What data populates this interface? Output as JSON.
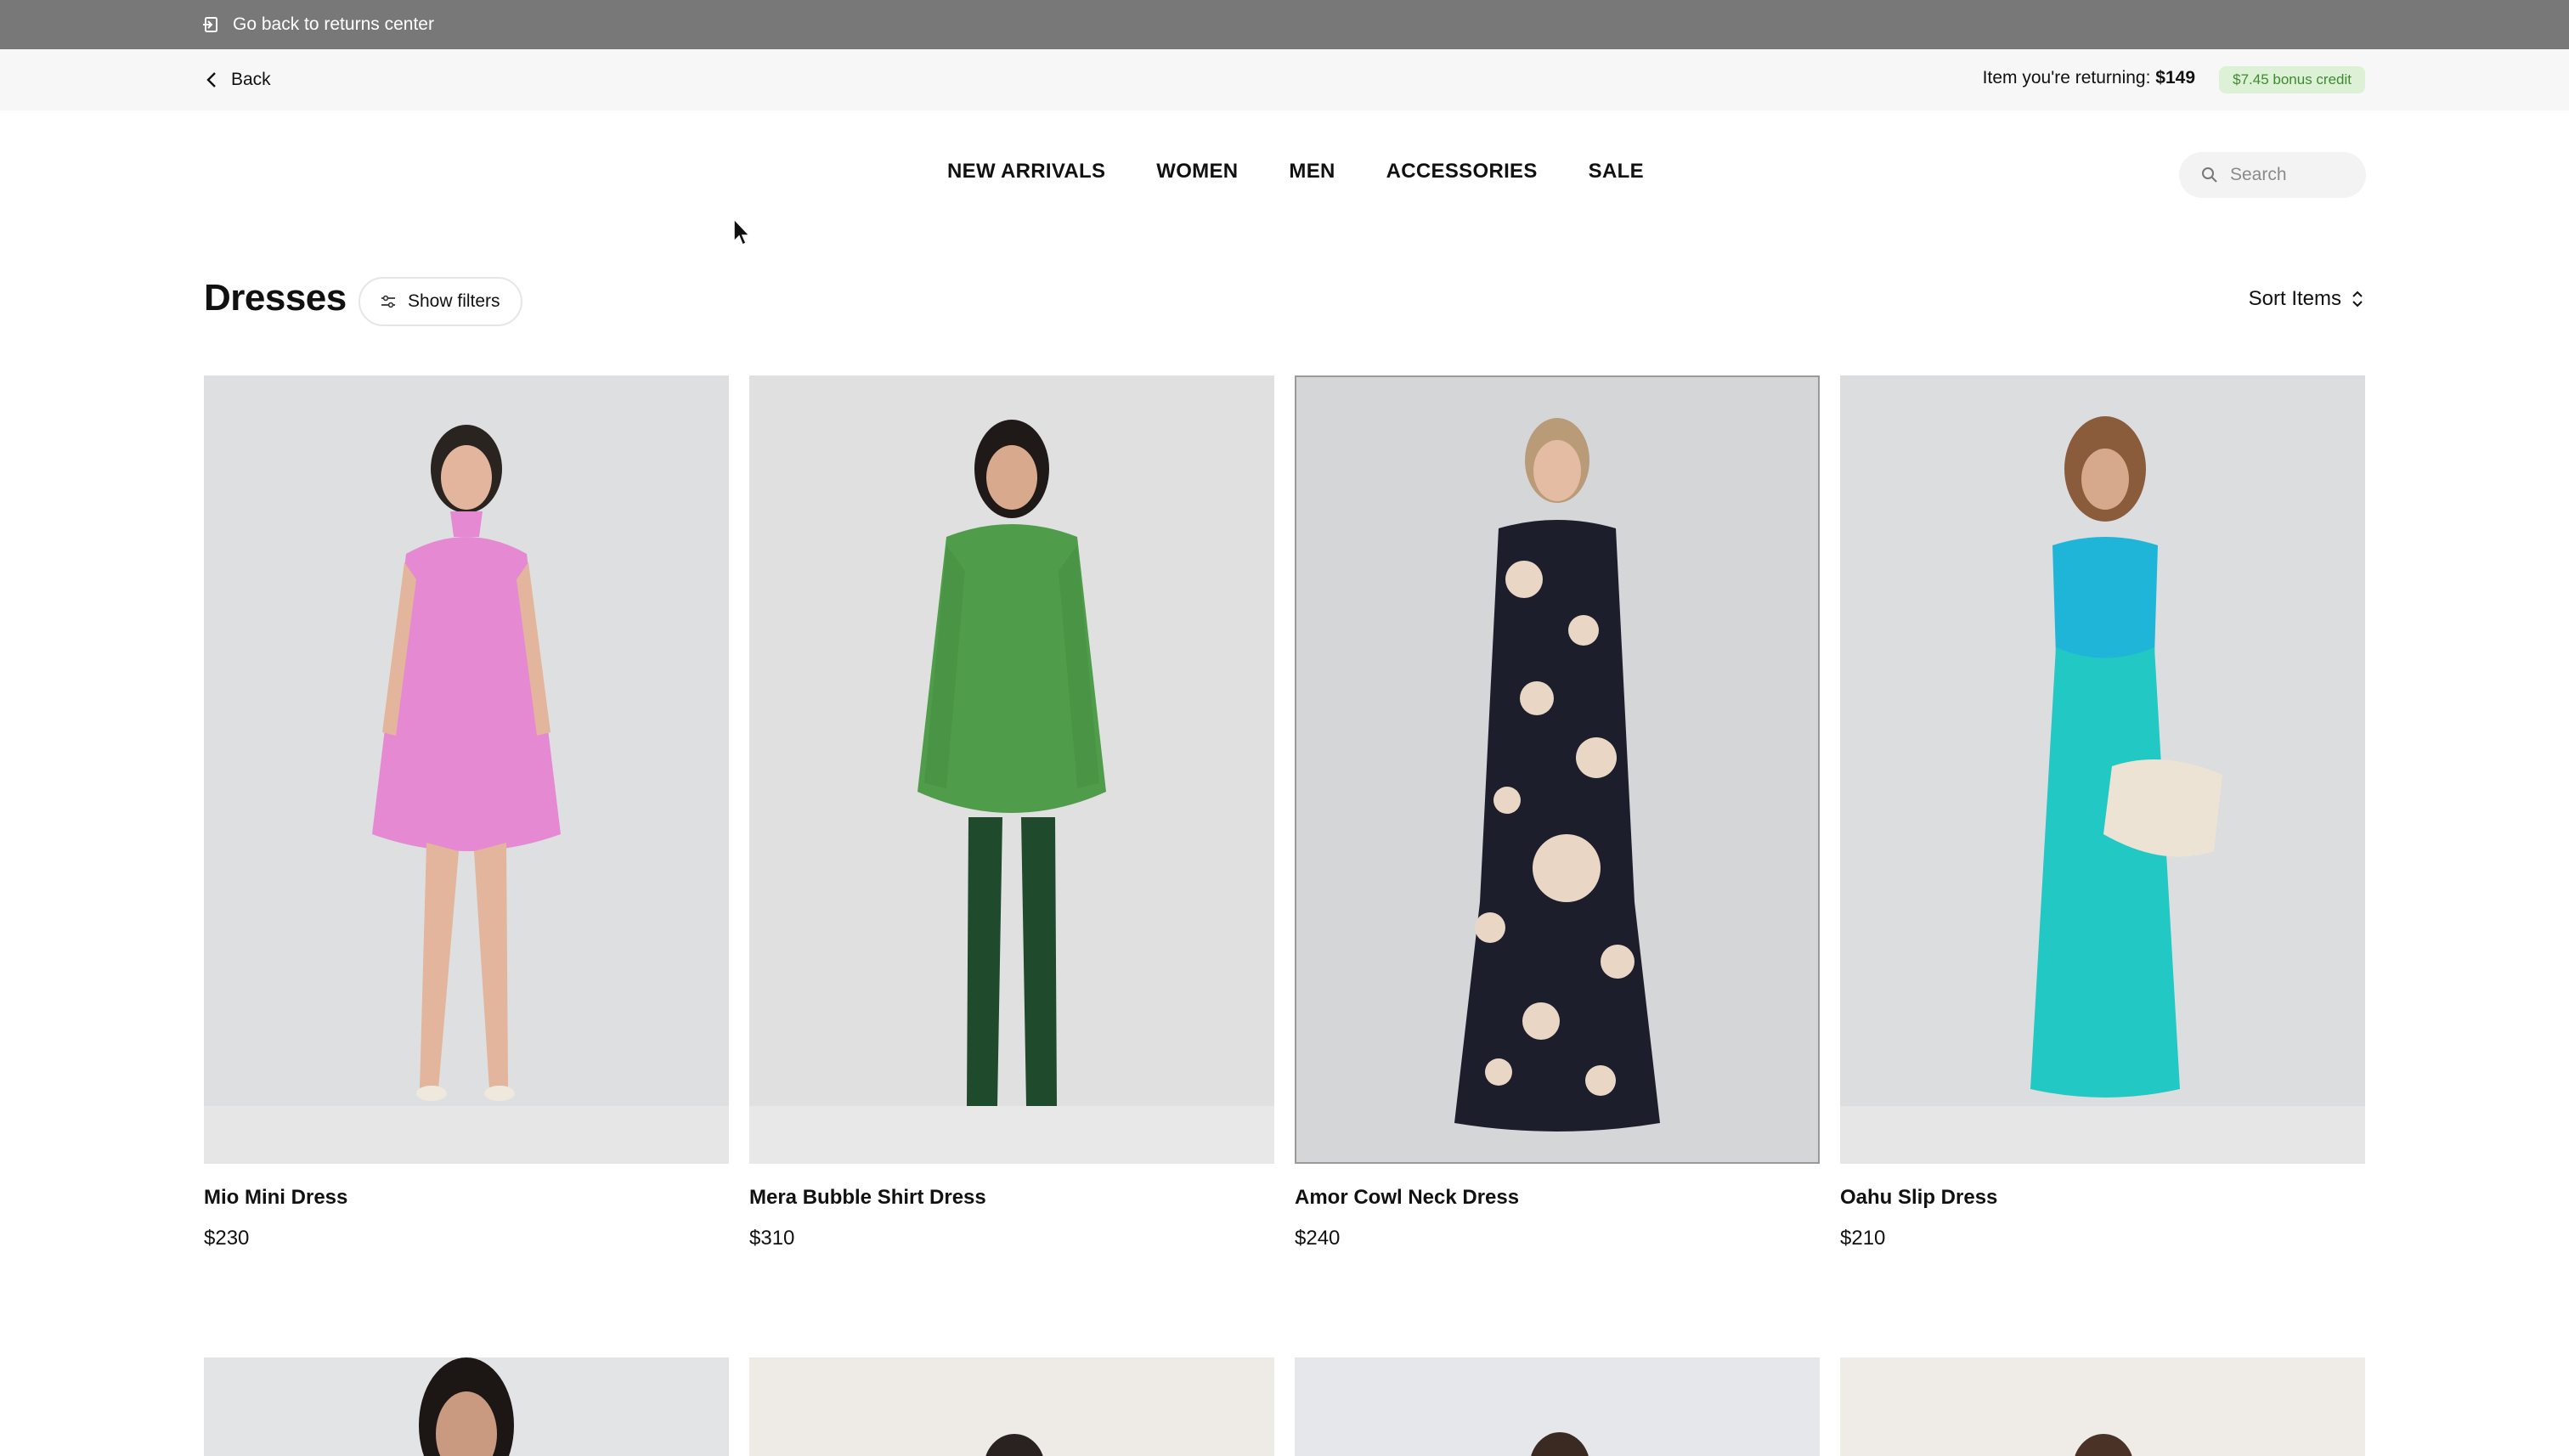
{
  "topbar": {
    "back_to_returns": "Go back to returns center"
  },
  "return_info": {
    "back_label": "Back",
    "returning_prefix": "Item you're returning:",
    "returning_value": "$149",
    "bonus_badge": "$7.45 bonus credit",
    "badge_color": "#3f8a2f"
  },
  "nav": {
    "links": [
      "NEW ARRIVALS",
      "WOMEN",
      "MEN",
      "ACCESSORIES",
      "SALE"
    ]
  },
  "search": {
    "placeholder": "Search",
    "icon": "search-icon"
  },
  "page": {
    "title": "Dresses",
    "filters_label": "Show filters",
    "sort_label": "Sort Items"
  },
  "products": [
    {
      "name": "Mio Mini Dress",
      "price": "$230",
      "color": "#e58ad2"
    },
    {
      "name": "Mera Bubble Shirt Dress",
      "price": "$310",
      "color": "#4f9d4a"
    },
    {
      "name": "Amor Cowl Neck Dress",
      "price": "$240",
      "color": "#1d1e2b"
    },
    {
      "name": "Oahu Slip Dress",
      "price": "$210",
      "color": "#22c8c3"
    }
  ]
}
